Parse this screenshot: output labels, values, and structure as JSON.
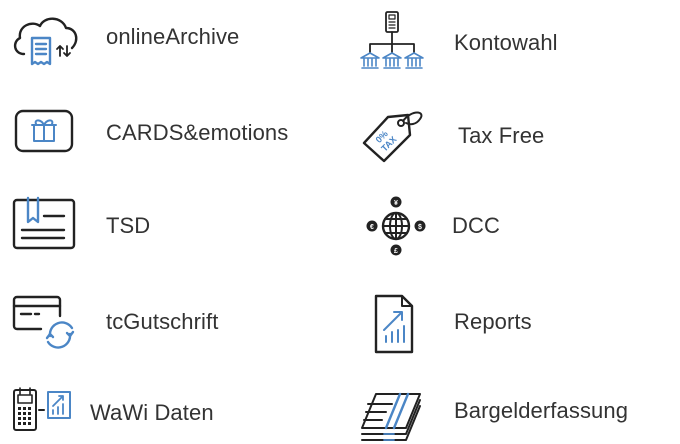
{
  "tiles": [
    {
      "label": "onlineArchive",
      "icon": "cloud-archive-icon"
    },
    {
      "label": "Kontowahl",
      "icon": "account-selection-icon"
    },
    {
      "label": "CARDS&emotions",
      "icon": "gift-card-icon"
    },
    {
      "label": "Tax Free",
      "icon": "tax-free-tag-icon"
    },
    {
      "label": "TSD",
      "icon": "tsd-card-icon"
    },
    {
      "label": "DCC",
      "icon": "currency-globe-icon"
    },
    {
      "label": "tcGutschrift",
      "icon": "card-refund-icon"
    },
    {
      "label": "Reports",
      "icon": "report-chart-icon"
    },
    {
      "label": "WaWi Daten",
      "icon": "terminal-data-icon"
    },
    {
      "label": "Bargelderfassung",
      "icon": "cash-stack-icon"
    }
  ],
  "tax_free_tag_text": [
    "0%",
    "TAX"
  ],
  "currency_symbols": {
    "top": "¥",
    "left": "€",
    "right": "$",
    "bottom": "£"
  },
  "colors": {
    "accent": "#4b86c6",
    "stroke": "#222222",
    "text": "#333333"
  }
}
